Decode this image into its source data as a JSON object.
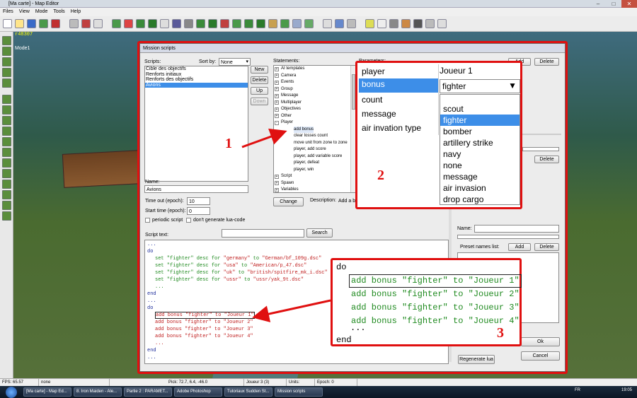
{
  "window": {
    "title": "[Ma carte] - Map Editor"
  },
  "menu": [
    "Files",
    "View",
    "Mode",
    "Tools",
    "Help"
  ],
  "overlay": {
    "coords": "r48307",
    "mode": "Mode1"
  },
  "dialog": {
    "title": "Mission scripts",
    "scripts_label": "Scripts:",
    "sort_label": "Sort by:",
    "sort_value": "None",
    "scripts": [
      "Cible des objectifs",
      "Renforts initiaux",
      "Renforts des objectifs",
      "Avions"
    ],
    "buttons": {
      "new": "New",
      "delete": "Delete",
      "up": "Up",
      "down": "Down",
      "change": "Change",
      "search": "Search",
      "add": "Add",
      "ok": "Ok",
      "cancel": "Cancel",
      "regenerate": "Regenerate lua"
    },
    "statements_label": "Statements:",
    "statements": [
      {
        "label": "AI templates",
        "level": 0,
        "toggle": "+"
      },
      {
        "label": "Camera",
        "level": 0,
        "toggle": "+"
      },
      {
        "label": "Events",
        "level": 0,
        "toggle": "+"
      },
      {
        "label": "Group",
        "level": 0,
        "toggle": "+"
      },
      {
        "label": "Message",
        "level": 0,
        "toggle": "+"
      },
      {
        "label": "Multiplayer",
        "level": 0,
        "toggle": "+"
      },
      {
        "label": "Objectives",
        "level": 0,
        "toggle": "+"
      },
      {
        "label": "Other",
        "level": 0,
        "toggle": "+"
      },
      {
        "label": "Player",
        "level": 0,
        "toggle": "-"
      },
      {
        "label": "add bonus",
        "level": 1,
        "toggle": ""
      },
      {
        "label": "clear losses count",
        "level": 1,
        "toggle": ""
      },
      {
        "label": "move unit from zone to zone",
        "level": 1,
        "toggle": ""
      },
      {
        "label": "player, add score",
        "level": 1,
        "toggle": ""
      },
      {
        "label": "player, add variable score",
        "level": 1,
        "toggle": ""
      },
      {
        "label": "player, defeat",
        "level": 1,
        "toggle": ""
      },
      {
        "label": "player, win",
        "level": 1,
        "toggle": ""
      },
      {
        "label": "Script",
        "level": 0,
        "toggle": "+"
      },
      {
        "label": "Spawn",
        "level": 0,
        "toggle": "+"
      },
      {
        "label": "Variables",
        "level": 0,
        "toggle": "+"
      }
    ],
    "parameters_label": "Parameters:",
    "name_label": "Name:",
    "name_value": "Avions",
    "timeout_label": "Time out (epoch):",
    "timeout_value": "10",
    "start_label": "Start time (epoch):",
    "start_value": "0",
    "periodic_label": "periodic script",
    "nolua_label": "don't generate lua-code",
    "description_label": "Description:",
    "description_value": "Add a bon",
    "script_text_label": "Script text:",
    "right_name_label": "Name:",
    "preset_label": "Preset names list:",
    "code": {
      "l1": "...",
      "l2": "do",
      "desc_prefix": "set \"fighter\" desc for ",
      "desc": [
        {
          "country": "\"germany\"",
          "path": "\"German/bf_109g.dsc\""
        },
        {
          "country": "\"usa\"",
          "path": "\"American/p_47.dsc\""
        },
        {
          "country": "\"uk\"",
          "path": "\"british/spitfire_mk_i.dsc\""
        },
        {
          "country": "\"ussr\"",
          "path": "\"ussr/yak_9t.dsc\""
        }
      ],
      "to_word": "to",
      "dots": "...",
      "end": "end",
      "bonus": [
        "add bonus \"fighter\" to \"Joueur 1\"",
        "add bonus \"fighter\" to \"Joueur 2\"",
        "add bonus \"fighter\" to \"Joueur 3\"",
        "add bonus \"fighter\" to \"Joueur 4\""
      ]
    }
  },
  "callout2": {
    "params": [
      "player",
      "bonus",
      "count",
      "message",
      "air invation type"
    ],
    "player_value": "Joueur 1",
    "bonus_value": "fighter",
    "options": [
      "scout",
      "fighter",
      "bomber",
      "artillery strike",
      "navy",
      "none",
      "message",
      "air invasion",
      "drop cargo"
    ],
    "selected_option": "fighter"
  },
  "callout3": {
    "do": "do",
    "lines": [
      "add bonus \"fighter\" to \"Joueur 1\"",
      "add bonus \"fighter\" to \"Joueur 2\"",
      "add bonus \"fighter\" to \"Joueur 3\"",
      "add bonus \"fighter\" to \"Joueur 4\""
    ],
    "dots": "...",
    "end": "end"
  },
  "numbers": {
    "n1": "1",
    "n2": "2",
    "n3": "3"
  },
  "status": [
    "FPS: 65.57",
    "none",
    "Pick: 72.7, 6.4, -46.0",
    "Joueur 3 (3)",
    "Units:",
    "Epoch: 0"
  ],
  "taskbar": [
    "[Ma carte] - Map Ed...",
    "8. Iron Maiden - Ale...",
    "Partie 2 : PARAMET...",
    "Adobe Photoshop",
    "Tutoriaux Sudden St...",
    "Mission scripts"
  ],
  "tray": {
    "lang": "FR",
    "time": "19:05"
  },
  "colors": {
    "accent": "#e01010",
    "selection": "#3d8ee8"
  }
}
